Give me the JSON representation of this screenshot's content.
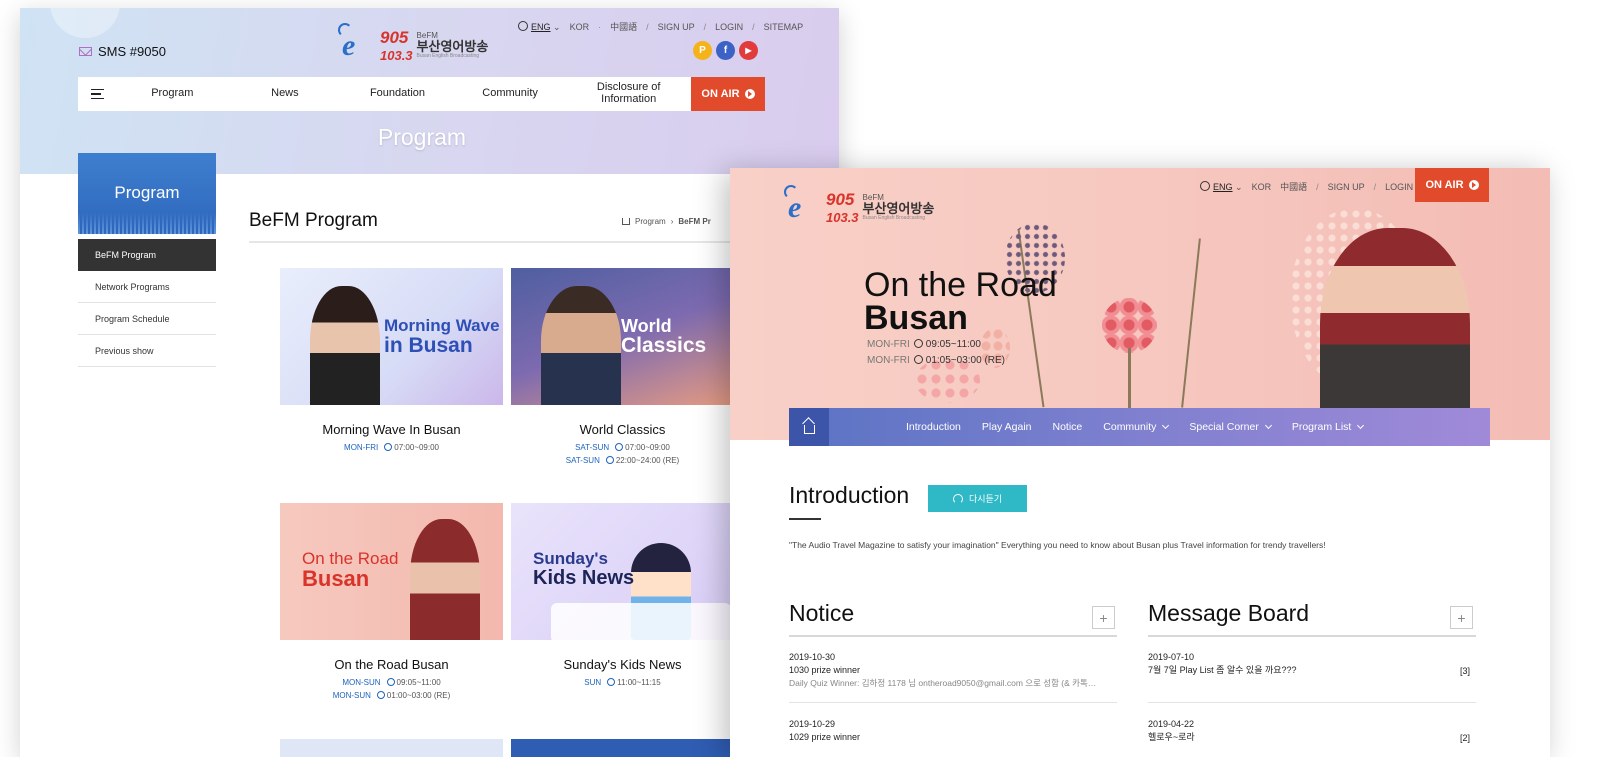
{
  "back": {
    "sms": "SMS #9050",
    "logo": {
      "e": "e",
      "fm1": "905",
      "fm2": "103.3",
      "brand": "BeFM",
      "name_ko": "부산영어방송",
      "name_en": "Busan English Broadcasting",
      "fm_label": "FM"
    },
    "util": {
      "eng": "ENG",
      "kor": "KOR",
      "cn": "中國語",
      "signup": "SIGN UP",
      "login": "LOGIN",
      "sitemap": "SITEMAP",
      "sep": "/",
      "dot": "·"
    },
    "social": [
      "P",
      "f",
      "▶"
    ],
    "nav": [
      "Program",
      "News",
      "Foundation",
      "Community",
      "Disclosure of Information"
    ],
    "onair": "ON AIR",
    "hero_title": "Program",
    "sidebar": {
      "title": "Program",
      "items": [
        "BeFM Program",
        "Network Programs",
        "Program Schedule",
        "Previous show"
      ]
    },
    "content_title": "BeFM Program",
    "breadcrumb": [
      "Program",
      "BeFM Pr"
    ],
    "cards": [
      {
        "name": "Morning Wave In Busan",
        "thumb": [
          "Morning Wave",
          "in Busan"
        ],
        "times": [
          {
            "day": "MON-FRI",
            "time": "07:00~09:00"
          }
        ]
      },
      {
        "name": "World Classics",
        "thumb": [
          "World",
          "Classics"
        ],
        "times": [
          {
            "day": "SAT-SUN",
            "time": "07:00~09:00"
          },
          {
            "day": "SAT-SUN",
            "time": "22:00~24:00 (RE)"
          }
        ]
      },
      {
        "name": "On the Road Busan",
        "thumb": [
          "On the Road",
          "Busan"
        ],
        "times": [
          {
            "day": "MON-SUN",
            "time": "09:05~11:00"
          },
          {
            "day": "MON-SUN",
            "time": "01:00~03:00 (RE)"
          }
        ]
      },
      {
        "name": "Sunday's Kids News",
        "thumb": [
          "Sunday's",
          "Kids News"
        ],
        "times": [
          {
            "day": "SUN",
            "time": "11:00~11:15"
          }
        ]
      }
    ]
  },
  "front": {
    "util": {
      "eng": "ENG",
      "kor": "KOR",
      "cn": "中國語",
      "signup": "SIGN UP",
      "login": "LOGIN",
      "sep": "/"
    },
    "onair": "ON AIR",
    "hero": {
      "title1": "On the Road",
      "title2": "Busan",
      "times": [
        {
          "day": "MON-FRI",
          "time": "09:05~11:00"
        },
        {
          "day": "MON-FRI",
          "time": "01:05~03:00 (RE)"
        }
      ]
    },
    "nav": [
      "Introduction",
      "Play Again",
      "Notice",
      "Community",
      "Special Corner",
      "Program List"
    ],
    "intro": {
      "title": "Introduction",
      "button": "다시듣기",
      "desc": "\"The Audio Travel Magazine to satisfy your imagination\" Everything you need to know about Busan plus Travel information for trendy travellers!"
    },
    "notice": {
      "title": "Notice",
      "plus": "+",
      "items": [
        {
          "date": "2019-10-30",
          "title": "1030 prize winner",
          "sub": "Daily Quiz Winner:  김하정 1178 님 ontheroad9050@gmail.com  으로 성함 (& 카톡…"
        },
        {
          "date": "2019-10-29",
          "title": "1029 prize winner"
        }
      ]
    },
    "board": {
      "title": "Message Board",
      "plus": "+",
      "items": [
        {
          "date": "2019-07-10",
          "title": "7월 7일 Play List 좀 알수 있을 까요???",
          "count": "[3]"
        },
        {
          "date": "2019-04-22",
          "title": "헬로우~로라",
          "count": "[2]"
        }
      ]
    }
  },
  "colors": {
    "accent": "#e14a2b",
    "blue": "#1d63bd",
    "teal": "#2fb8c6",
    "navStart": "#5b73c4",
    "navEnd": "#a08ad8"
  }
}
